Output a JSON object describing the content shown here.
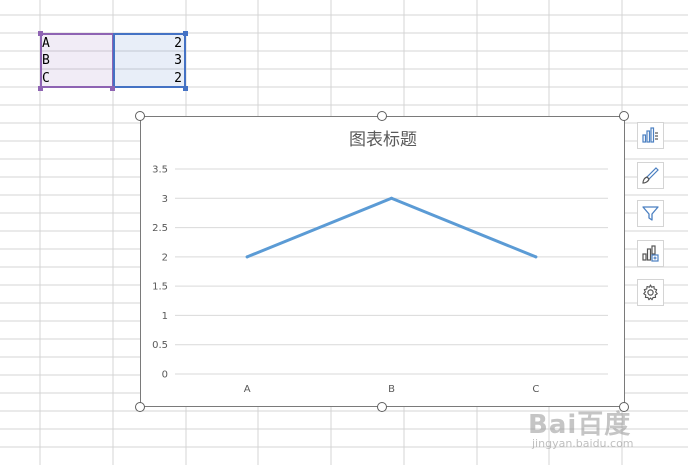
{
  "sheet": {
    "cells": [
      {
        "label": "A",
        "value": "2"
      },
      {
        "label": "B",
        "value": "3"
      },
      {
        "label": "C",
        "value": "2"
      }
    ]
  },
  "chart_data": {
    "type": "line",
    "title": "图表标题",
    "categories": [
      "A",
      "B",
      "C"
    ],
    "series": [
      {
        "values": [
          2,
          3,
          2
        ],
        "color": "#5b9bd5"
      }
    ],
    "ylim": [
      0,
      3.5
    ],
    "yticks": [
      "0",
      "0.5",
      "1",
      "1.5",
      "2",
      "2.5",
      "3",
      "3.5"
    ],
    "grid": true,
    "legend": "none"
  },
  "chart_tools": [
    {
      "name": "chart-elements-icon"
    },
    {
      "name": "chart-style-icon"
    },
    {
      "name": "chart-filter-icon"
    },
    {
      "name": "chart-quick-layout-icon"
    },
    {
      "name": "chart-settings-icon"
    }
  ],
  "colors": {
    "grid": "#d4d4d4",
    "label_selection": "#8e63b3",
    "value_selection": "#4472c4",
    "line": "#5b9bd5"
  },
  "watermark": {
    "brand": "Bai百度",
    "url": "jingyan.baidu.com"
  }
}
